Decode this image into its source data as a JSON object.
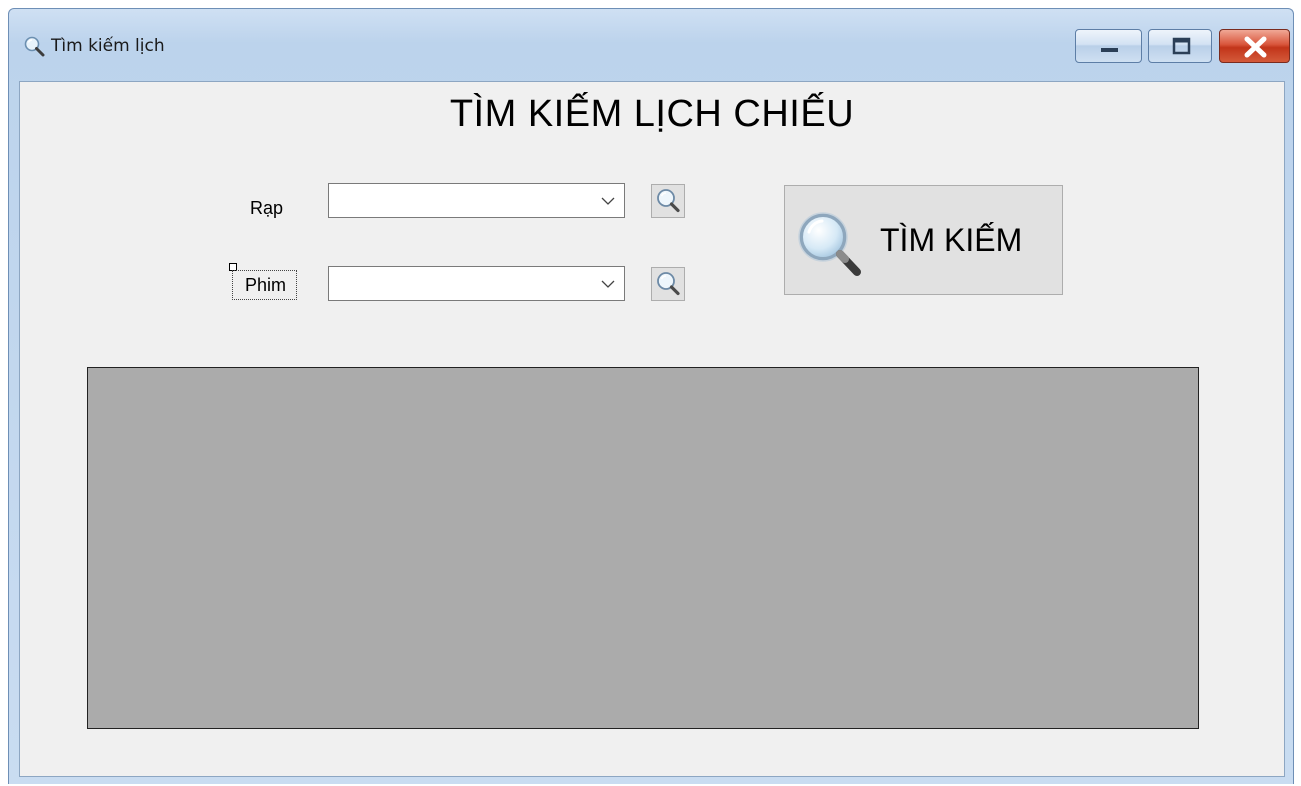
{
  "window": {
    "title": "Tìm kiếm lịch",
    "title_icon": "magnifier-icon",
    "controls": [
      "minimize-icon",
      "maximize-icon",
      "close-icon"
    ]
  },
  "heading": "TÌM KIẾM LỊCH CHIẾU",
  "filters": {
    "rap": {
      "label": "Rạp",
      "value": ""
    },
    "phim": {
      "label": "Phim",
      "value": ""
    }
  },
  "search_button": {
    "label": "TÌM KIẾM",
    "icon": "magnifier-icon"
  },
  "results_grid": {
    "rows": []
  },
  "colors": {
    "client_background": "#f0f0f0",
    "grid_background": "#ababab",
    "close_button": "#c2351a",
    "titlebar": "#bcd3ec"
  }
}
